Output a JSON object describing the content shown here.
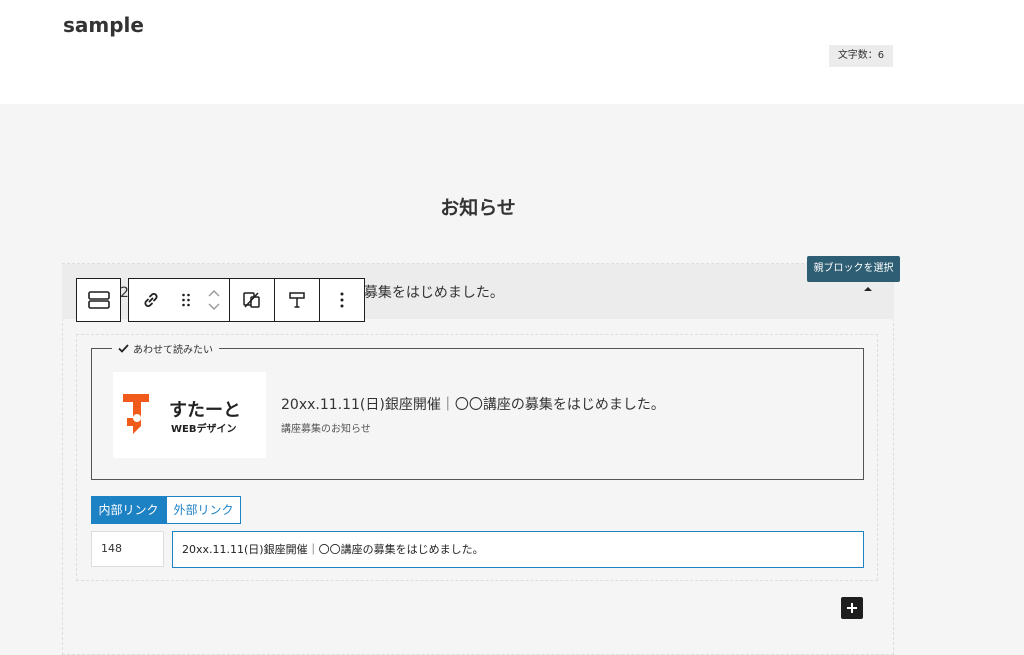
{
  "post": {
    "title": "sample",
    "char_count": "文字数：6"
  },
  "section": {
    "heading": "お知らせ"
  },
  "tooltip": "親ブロックを選択",
  "accordion": {
    "title": "20xx.11.11(日)銀座開催｜〇〇講座の募集をはじめました。"
  },
  "toolbar": {
    "icons": [
      "group-block-icon",
      "link-icon",
      "drag-handle-icon",
      "move-up-icon",
      "move-down-icon",
      "device-visibility-icon",
      "text-align-icon",
      "more-options-icon"
    ]
  },
  "related_card": {
    "label": "あわせて読みたい",
    "title": "20xx.11.11(日)銀座開催｜〇〇講座の募集をはじめました。",
    "excerpt": "講座募集のお知らせ",
    "logo": {
      "main": "すたーと",
      "sub": "WEBデザイン",
      "mark_color": "#f05a1a"
    }
  },
  "link_tabs": {
    "internal": "内部リンク",
    "external": "外部リンク",
    "active": "internal"
  },
  "fields": {
    "post_id": "148",
    "post_title": "20xx.11.11(日)銀座開催｜〇〇講座の募集をはじめました。"
  },
  "colors": {
    "accent": "#1d82c4",
    "tooltip_bg": "#2e5e73"
  }
}
